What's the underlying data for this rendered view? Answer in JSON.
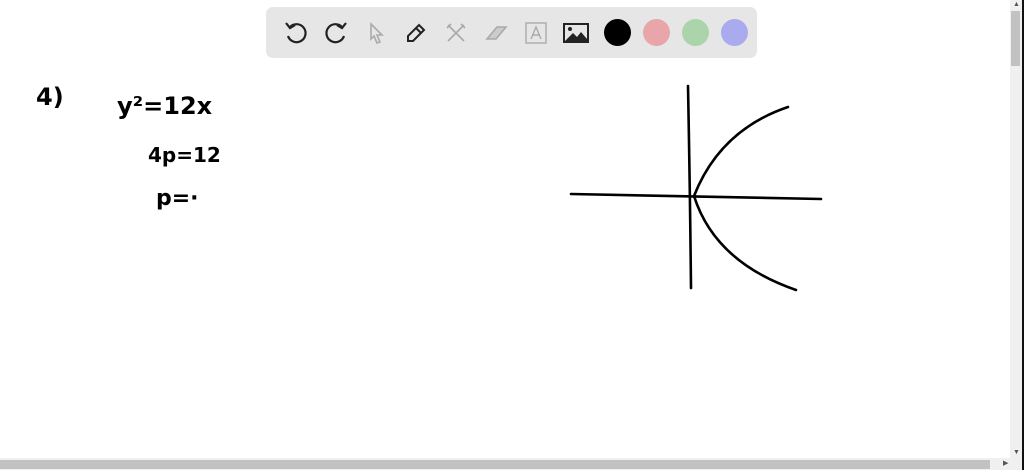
{
  "toolbar": {
    "tools": [
      "undo-icon",
      "redo-icon",
      "pointer-icon",
      "pen-icon",
      "tools-icon",
      "eraser-icon",
      "text-icon",
      "image-icon"
    ],
    "colors": [
      "#000000",
      "#e8a5aa",
      "#acd4ab",
      "#aaaaee"
    ]
  },
  "notes": {
    "problem_number": "4)",
    "line1": "y²=12x",
    "line2": "4p=12",
    "line3": "p=·"
  }
}
